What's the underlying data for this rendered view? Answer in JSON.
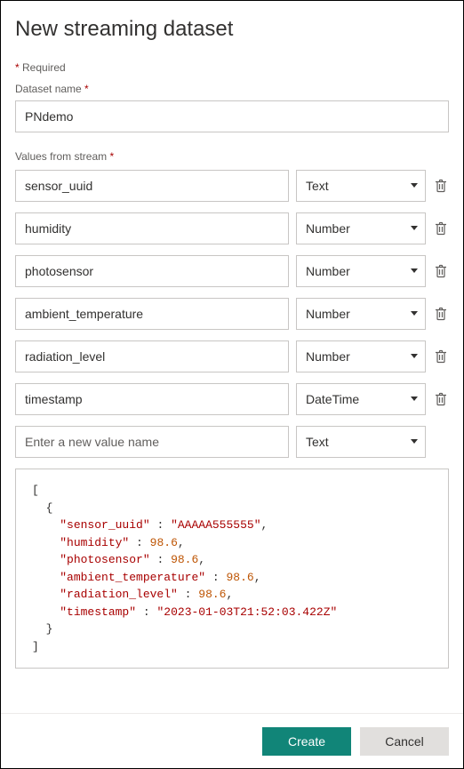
{
  "title": "New streaming dataset",
  "required_note_prefix": "*",
  "required_note_text": " Required",
  "labels": {
    "dataset_name": "Dataset name",
    "values_from_stream": "Values from stream",
    "create": "Create",
    "cancel": "Cancel"
  },
  "required_star": " *",
  "dataset_name_value": "PNdemo",
  "type_options": [
    "Text",
    "Number",
    "DateTime"
  ],
  "rows": [
    {
      "name": "sensor_uuid",
      "type": "Text"
    },
    {
      "name": "humidity",
      "type": "Number"
    },
    {
      "name": "photosensor",
      "type": "Number"
    },
    {
      "name": "ambient_temperature",
      "type": "Number"
    },
    {
      "name": "radiation_level",
      "type": "Number"
    },
    {
      "name": "timestamp",
      "type": "DateTime"
    }
  ],
  "new_row": {
    "placeholder": "Enter a new value name",
    "type": "Text"
  },
  "json_preview": {
    "sensor_uuid": "AAAAA555555",
    "humidity": 98.6,
    "photosensor": 98.6,
    "ambient_temperature": 98.6,
    "radiation_level": 98.6,
    "timestamp": "2023-01-03T21:52:03.422Z"
  }
}
